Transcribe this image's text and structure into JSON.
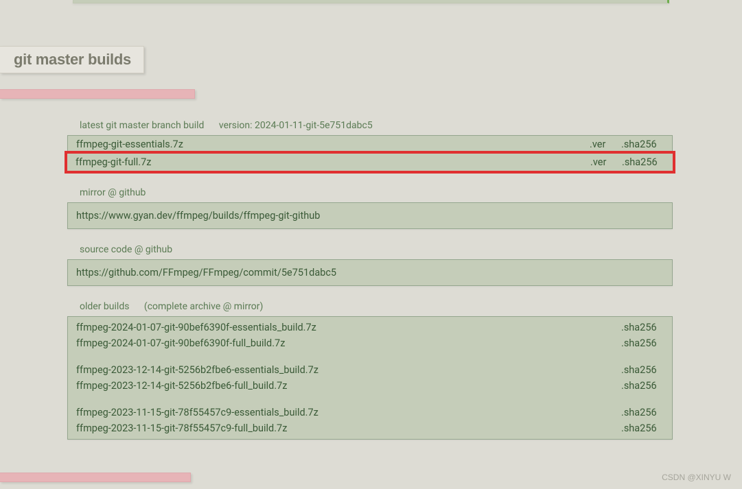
{
  "heading": "git master builds",
  "latest": {
    "label": "latest git master branch build",
    "version_label": "version: 2024-01-11-git-5e751dabc5",
    "rows": [
      {
        "name": "ffmpeg-git-essentials.7z",
        "ver": ".ver",
        "sha": ".sha256",
        "highlight": false
      },
      {
        "name": "ffmpeg-git-full.7z",
        "ver": ".ver",
        "sha": ".sha256",
        "highlight": true
      }
    ]
  },
  "mirror": {
    "label": "mirror @ github",
    "url": "https://www.gyan.dev/ffmpeg/builds/ffmpeg-git-github"
  },
  "source": {
    "label": "source code @ github",
    "url": "https://github.com/FFmpeg/FFmpeg/commit/5e751dabc5"
  },
  "older": {
    "label": "older builds",
    "sub": "(complete archive @ mirror)",
    "groups": [
      [
        {
          "name": "ffmpeg-2024-01-07-git-90bef6390f-essentials_build.7z",
          "sha": ".sha256"
        },
        {
          "name": "ffmpeg-2024-01-07-git-90bef6390f-full_build.7z",
          "sha": ".sha256"
        }
      ],
      [
        {
          "name": "ffmpeg-2023-12-14-git-5256b2fbe6-essentials_build.7z",
          "sha": ".sha256"
        },
        {
          "name": "ffmpeg-2023-12-14-git-5256b2fbe6-full_build.7z",
          "sha": ".sha256"
        }
      ],
      [
        {
          "name": "ffmpeg-2023-11-15-git-78f55457c9-essentials_build.7z",
          "sha": ".sha256"
        },
        {
          "name": "ffmpeg-2023-11-15-git-78f55457c9-full_build.7z",
          "sha": ".sha256"
        }
      ]
    ]
  },
  "watermark": "CSDN @XINYU W"
}
